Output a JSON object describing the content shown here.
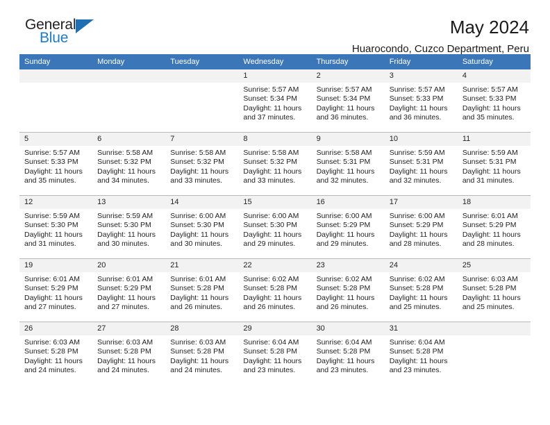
{
  "brand": {
    "name_top": "General",
    "name_bottom": "Blue",
    "triangle_color": "#1f6fb5",
    "blue_color": "#1f7ac4"
  },
  "header": {
    "title": "May 2024",
    "subtitle": "Huarocondo, Cuzco Department, Peru"
  },
  "theme": {
    "header_row_bg": "#3a76b8",
    "header_row_text": "#ffffff",
    "daynum_bg": "#f2f2f2",
    "grid_line": "#b9b9b9",
    "body_text": "#222222"
  },
  "weekday_headers": [
    "Sunday",
    "Monday",
    "Tuesday",
    "Wednesday",
    "Thursday",
    "Friday",
    "Saturday"
  ],
  "labels": {
    "sunrise": "Sunrise:",
    "sunset": "Sunset:",
    "daylight": "Daylight:"
  },
  "weeks": [
    [
      {
        "empty": true
      },
      {
        "empty": true
      },
      {
        "empty": true
      },
      {
        "day": "1",
        "sunrise": "Sunrise: 5:57 AM",
        "sunset": "Sunset: 5:34 PM",
        "daylight_1": "Daylight: 11 hours",
        "daylight_2": "and 37 minutes."
      },
      {
        "day": "2",
        "sunrise": "Sunrise: 5:57 AM",
        "sunset": "Sunset: 5:34 PM",
        "daylight_1": "Daylight: 11 hours",
        "daylight_2": "and 36 minutes."
      },
      {
        "day": "3",
        "sunrise": "Sunrise: 5:57 AM",
        "sunset": "Sunset: 5:33 PM",
        "daylight_1": "Daylight: 11 hours",
        "daylight_2": "and 36 minutes."
      },
      {
        "day": "4",
        "sunrise": "Sunrise: 5:57 AM",
        "sunset": "Sunset: 5:33 PM",
        "daylight_1": "Daylight: 11 hours",
        "daylight_2": "and 35 minutes."
      }
    ],
    [
      {
        "day": "5",
        "sunrise": "Sunrise: 5:57 AM",
        "sunset": "Sunset: 5:33 PM",
        "daylight_1": "Daylight: 11 hours",
        "daylight_2": "and 35 minutes."
      },
      {
        "day": "6",
        "sunrise": "Sunrise: 5:58 AM",
        "sunset": "Sunset: 5:32 PM",
        "daylight_1": "Daylight: 11 hours",
        "daylight_2": "and 34 minutes."
      },
      {
        "day": "7",
        "sunrise": "Sunrise: 5:58 AM",
        "sunset": "Sunset: 5:32 PM",
        "daylight_1": "Daylight: 11 hours",
        "daylight_2": "and 33 minutes."
      },
      {
        "day": "8",
        "sunrise": "Sunrise: 5:58 AM",
        "sunset": "Sunset: 5:32 PM",
        "daylight_1": "Daylight: 11 hours",
        "daylight_2": "and 33 minutes."
      },
      {
        "day": "9",
        "sunrise": "Sunrise: 5:58 AM",
        "sunset": "Sunset: 5:31 PM",
        "daylight_1": "Daylight: 11 hours",
        "daylight_2": "and 32 minutes."
      },
      {
        "day": "10",
        "sunrise": "Sunrise: 5:59 AM",
        "sunset": "Sunset: 5:31 PM",
        "daylight_1": "Daylight: 11 hours",
        "daylight_2": "and 32 minutes."
      },
      {
        "day": "11",
        "sunrise": "Sunrise: 5:59 AM",
        "sunset": "Sunset: 5:31 PM",
        "daylight_1": "Daylight: 11 hours",
        "daylight_2": "and 31 minutes."
      }
    ],
    [
      {
        "day": "12",
        "sunrise": "Sunrise: 5:59 AM",
        "sunset": "Sunset: 5:30 PM",
        "daylight_1": "Daylight: 11 hours",
        "daylight_2": "and 31 minutes."
      },
      {
        "day": "13",
        "sunrise": "Sunrise: 5:59 AM",
        "sunset": "Sunset: 5:30 PM",
        "daylight_1": "Daylight: 11 hours",
        "daylight_2": "and 30 minutes."
      },
      {
        "day": "14",
        "sunrise": "Sunrise: 6:00 AM",
        "sunset": "Sunset: 5:30 PM",
        "daylight_1": "Daylight: 11 hours",
        "daylight_2": "and 30 minutes."
      },
      {
        "day": "15",
        "sunrise": "Sunrise: 6:00 AM",
        "sunset": "Sunset: 5:30 PM",
        "daylight_1": "Daylight: 11 hours",
        "daylight_2": "and 29 minutes."
      },
      {
        "day": "16",
        "sunrise": "Sunrise: 6:00 AM",
        "sunset": "Sunset: 5:29 PM",
        "daylight_1": "Daylight: 11 hours",
        "daylight_2": "and 29 minutes."
      },
      {
        "day": "17",
        "sunrise": "Sunrise: 6:00 AM",
        "sunset": "Sunset: 5:29 PM",
        "daylight_1": "Daylight: 11 hours",
        "daylight_2": "and 28 minutes."
      },
      {
        "day": "18",
        "sunrise": "Sunrise: 6:01 AM",
        "sunset": "Sunset: 5:29 PM",
        "daylight_1": "Daylight: 11 hours",
        "daylight_2": "and 28 minutes."
      }
    ],
    [
      {
        "day": "19",
        "sunrise": "Sunrise: 6:01 AM",
        "sunset": "Sunset: 5:29 PM",
        "daylight_1": "Daylight: 11 hours",
        "daylight_2": "and 27 minutes."
      },
      {
        "day": "20",
        "sunrise": "Sunrise: 6:01 AM",
        "sunset": "Sunset: 5:29 PM",
        "daylight_1": "Daylight: 11 hours",
        "daylight_2": "and 27 minutes."
      },
      {
        "day": "21",
        "sunrise": "Sunrise: 6:01 AM",
        "sunset": "Sunset: 5:28 PM",
        "daylight_1": "Daylight: 11 hours",
        "daylight_2": "and 26 minutes."
      },
      {
        "day": "22",
        "sunrise": "Sunrise: 6:02 AM",
        "sunset": "Sunset: 5:28 PM",
        "daylight_1": "Daylight: 11 hours",
        "daylight_2": "and 26 minutes."
      },
      {
        "day": "23",
        "sunrise": "Sunrise: 6:02 AM",
        "sunset": "Sunset: 5:28 PM",
        "daylight_1": "Daylight: 11 hours",
        "daylight_2": "and 26 minutes."
      },
      {
        "day": "24",
        "sunrise": "Sunrise: 6:02 AM",
        "sunset": "Sunset: 5:28 PM",
        "daylight_1": "Daylight: 11 hours",
        "daylight_2": "and 25 minutes."
      },
      {
        "day": "25",
        "sunrise": "Sunrise: 6:03 AM",
        "sunset": "Sunset: 5:28 PM",
        "daylight_1": "Daylight: 11 hours",
        "daylight_2": "and 25 minutes."
      }
    ],
    [
      {
        "day": "26",
        "sunrise": "Sunrise: 6:03 AM",
        "sunset": "Sunset: 5:28 PM",
        "daylight_1": "Daylight: 11 hours",
        "daylight_2": "and 24 minutes."
      },
      {
        "day": "27",
        "sunrise": "Sunrise: 6:03 AM",
        "sunset": "Sunset: 5:28 PM",
        "daylight_1": "Daylight: 11 hours",
        "daylight_2": "and 24 minutes."
      },
      {
        "day": "28",
        "sunrise": "Sunrise: 6:03 AM",
        "sunset": "Sunset: 5:28 PM",
        "daylight_1": "Daylight: 11 hours",
        "daylight_2": "and 24 minutes."
      },
      {
        "day": "29",
        "sunrise": "Sunrise: 6:04 AM",
        "sunset": "Sunset: 5:28 PM",
        "daylight_1": "Daylight: 11 hours",
        "daylight_2": "and 23 minutes."
      },
      {
        "day": "30",
        "sunrise": "Sunrise: 6:04 AM",
        "sunset": "Sunset: 5:28 PM",
        "daylight_1": "Daylight: 11 hours",
        "daylight_2": "and 23 minutes."
      },
      {
        "day": "31",
        "sunrise": "Sunrise: 6:04 AM",
        "sunset": "Sunset: 5:28 PM",
        "daylight_1": "Daylight: 11 hours",
        "daylight_2": "and 23 minutes."
      },
      {
        "empty": true
      }
    ]
  ]
}
